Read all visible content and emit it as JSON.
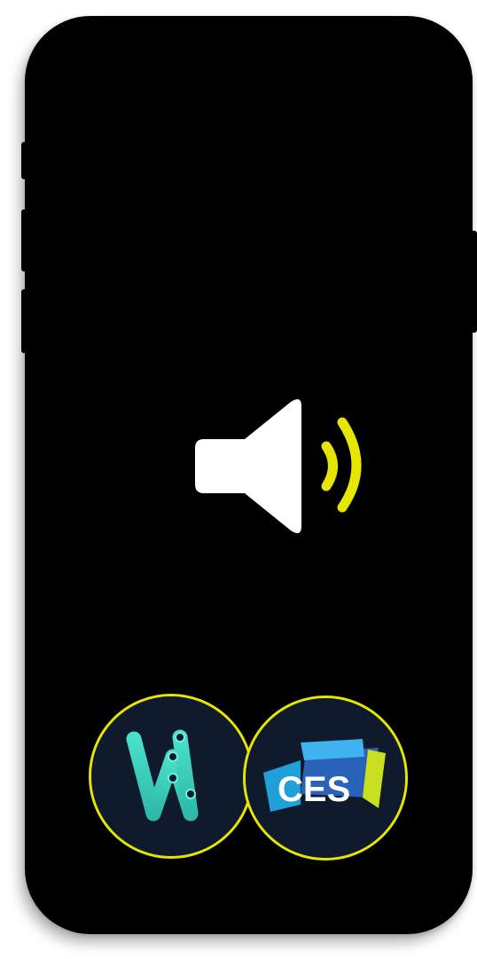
{
  "screen": {
    "background": "#000000",
    "accent": "#e6e600"
  },
  "speaker": {
    "icon": "speaker-volume-icon",
    "body_color": "#ffffff",
    "wave_color": "#e6e600"
  },
  "logos": [
    {
      "id": "w-logo",
      "icon": "w-logo-icon"
    },
    {
      "id": "ces-logo",
      "icon": "ces-logo-icon",
      "text": "CES"
    }
  ]
}
